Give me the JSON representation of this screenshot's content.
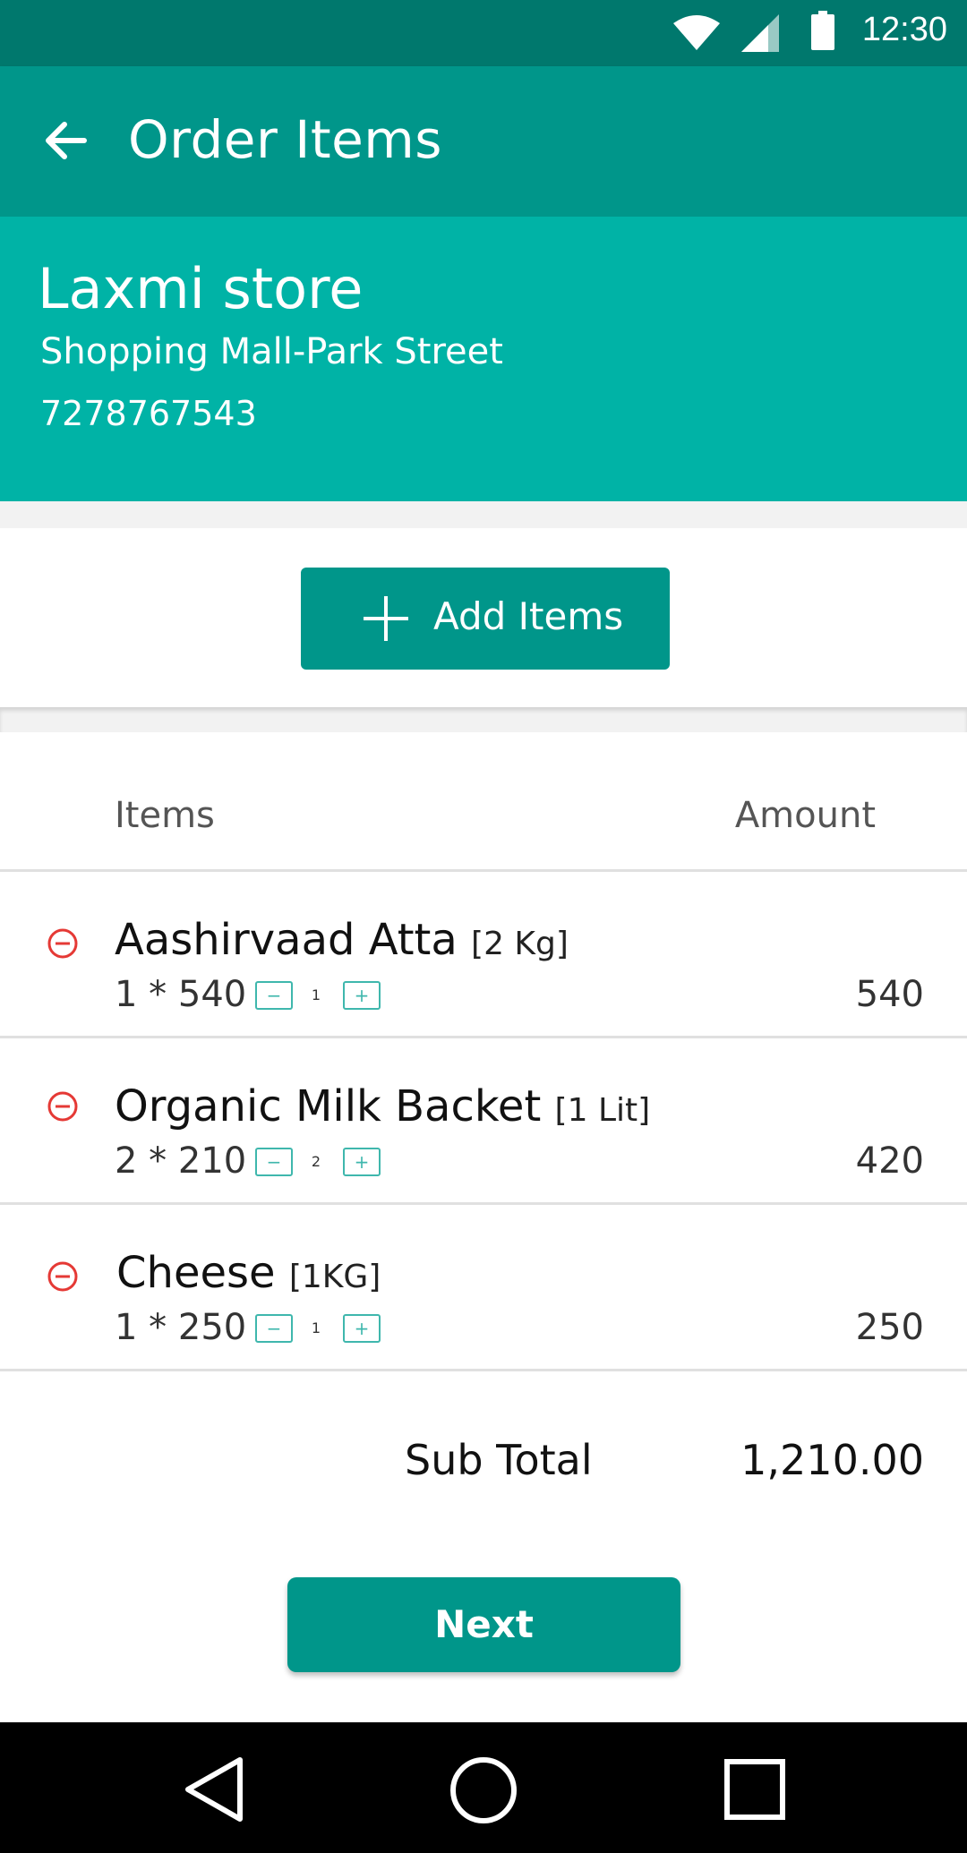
{
  "status_bar": {
    "time": "12:30",
    "icons": [
      "wifi-icon",
      "signal-icon",
      "battery-icon"
    ]
  },
  "app_bar": {
    "title": "Order Items",
    "back_icon": "arrow-left-icon"
  },
  "store": {
    "name": "Laxmi store",
    "address": "Shopping Mall-Park Street",
    "phone": "7278767543"
  },
  "add_items": {
    "label": "Add Items",
    "icon": "plus-icon"
  },
  "table": {
    "header_items": "Items",
    "header_amount": "Amount",
    "rows": [
      {
        "name": "Aashirvaad Atta",
        "unit": "[2 Kg]",
        "qty_text": "1 * 540",
        "minus": "−",
        "qty": "1",
        "plus": "+",
        "amount": "540"
      },
      {
        "name": "Organic Milk Backet",
        "unit": "[1 Lit]",
        "qty_text": "2 * 210",
        "minus": "−",
        "qty": "2",
        "plus": "+",
        "amount": "420"
      },
      {
        "name": "Cheese",
        "unit": "[1KG]",
        "qty_text": "1 * 250",
        "minus": "−",
        "qty": "1",
        "plus": "+",
        "amount": "250"
      }
    ]
  },
  "summary": {
    "subtotal_label": "Sub Total",
    "subtotal_value": "1,210.00"
  },
  "next_button": {
    "label": "Next"
  },
  "nav_bar": {
    "icons": [
      "back-triangle-icon",
      "home-circle-icon",
      "recents-square-icon"
    ]
  },
  "colors": {
    "status_bar": "#00786d",
    "app_bar": "#00968a",
    "store_header": "#00b3a6",
    "accent": "#00968a",
    "remove": "#e53935"
  }
}
